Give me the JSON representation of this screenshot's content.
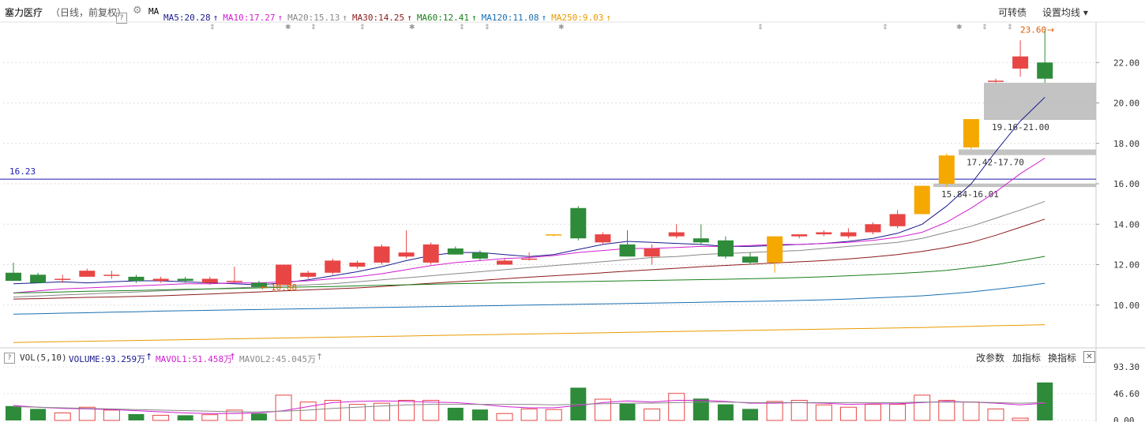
{
  "header": {
    "stock_name": "塞力医疗",
    "mode": "（日线，前复权）",
    "help": "?",
    "ma_label": "MA",
    "ma_items": [
      {
        "text": "MA5:20.28",
        "arrow": "↑",
        "color": "#1a1a8c"
      },
      {
        "text": "MA10:17.27",
        "arrow": "↑",
        "color": "#d020d0"
      },
      {
        "text": "MA20:15.13",
        "arrow": "↑",
        "color": "#888888"
      },
      {
        "text": "MA30:14.25",
        "arrow": "↑",
        "color": "#8b1a1a"
      },
      {
        "text": "MA60:12.41",
        "arrow": "↑",
        "color": "#1a7f1a"
      },
      {
        "text": "MA120:11.08",
        "arrow": "↑",
        "color": "#1a6fb0"
      },
      {
        "text": "MA250:9.03",
        "arrow": "↑",
        "color": "#e89b00"
      }
    ],
    "btn_convert": "可转债",
    "btn_setma": "设置均线 ▾"
  },
  "vol_header": {
    "help": "?",
    "label": "VOL(5,10)",
    "volume": "VOLUME:93.259万",
    "mavol1": "MAVOL1:51.458万",
    "mavol2": "MAVOL2:45.045万",
    "arrow": "↑",
    "btn_params": "改参数",
    "btn_add": "加指标",
    "btn_switch": "换指标",
    "btn_close": "✕"
  },
  "colors": {
    "up": "#e84545",
    "down": "#2e8b3a",
    "limit": "#f5a800",
    "hline": "#1a1ab0",
    "vol_up_fill": "#ffffff"
  },
  "chart_data": {
    "type": "candlestick",
    "y_ticks": [
      "22.00",
      "20.00",
      "18.00",
      "16.00",
      "14.00",
      "12.00",
      "10.00"
    ],
    "ylim": [
      8.0,
      24.0
    ],
    "hline": {
      "value": 16.23,
      "label": "16.23"
    },
    "max_label": "23.60",
    "min_label": "10.88",
    "gaps": [
      {
        "low": 19.16,
        "high": 21.0,
        "label": "19.16-21.00"
      },
      {
        "low": 17.42,
        "high": 17.7,
        "label": "17.42-17.70"
      },
      {
        "low": 15.84,
        "high": 16.01,
        "label": "15.84-16.01"
      }
    ],
    "candles": [
      {
        "o": 11.6,
        "h": 12.1,
        "l": 11.3,
        "c": 11.2
      },
      {
        "o": 11.5,
        "h": 11.6,
        "l": 11.1,
        "c": 11.1
      },
      {
        "o": 11.3,
        "h": 11.5,
        "l": 11.1,
        "c": 11.3
      },
      {
        "o": 11.4,
        "h": 11.8,
        "l": 11.4,
        "c": 11.7
      },
      {
        "o": 11.5,
        "h": 11.7,
        "l": 11.3,
        "c": 11.5
      },
      {
        "o": 11.4,
        "h": 11.5,
        "l": 11.1,
        "c": 11.2
      },
      {
        "o": 11.2,
        "h": 11.4,
        "l": 11.1,
        "c": 11.3
      },
      {
        "o": 11.3,
        "h": 11.4,
        "l": 11.1,
        "c": 11.2
      },
      {
        "o": 11.1,
        "h": 11.4,
        "l": 11.0,
        "c": 11.3
      },
      {
        "o": 11.2,
        "h": 11.9,
        "l": 11.1,
        "c": 11.2
      },
      {
        "o": 11.1,
        "h": 11.2,
        "l": 10.88,
        "c": 10.9
      },
      {
        "o": 11.0,
        "h": 12.0,
        "l": 11.0,
        "c": 12.0
      },
      {
        "o": 11.4,
        "h": 11.7,
        "l": 11.3,
        "c": 11.6
      },
      {
        "o": 11.6,
        "h": 12.3,
        "l": 11.5,
        "c": 12.2
      },
      {
        "o": 11.9,
        "h": 12.2,
        "l": 11.8,
        "c": 12.1
      },
      {
        "o": 12.1,
        "h": 13.0,
        "l": 12.0,
        "c": 12.9
      },
      {
        "o": 12.4,
        "h": 13.7,
        "l": 12.3,
        "c": 12.6
      },
      {
        "o": 12.1,
        "h": 13.1,
        "l": 12.0,
        "c": 13.0
      },
      {
        "o": 12.8,
        "h": 12.9,
        "l": 12.5,
        "c": 12.5
      },
      {
        "o": 12.6,
        "h": 12.7,
        "l": 12.2,
        "c": 12.3
      },
      {
        "o": 12.0,
        "h": 12.3,
        "l": 12.0,
        "c": 12.2
      },
      {
        "o": 12.3,
        "h": 12.6,
        "l": 12.2,
        "c": 12.3
      },
      {
        "o": 13.45,
        "h": 13.5,
        "l": 13.4,
        "c": 13.5
      },
      {
        "o": 14.8,
        "h": 14.9,
        "l": 13.2,
        "c": 13.3
      },
      {
        "o": 13.1,
        "h": 13.6,
        "l": 13.0,
        "c": 13.5
      },
      {
        "o": 13.0,
        "h": 13.7,
        "l": 12.4,
        "c": 12.4
      },
      {
        "o": 12.4,
        "h": 13.0,
        "l": 12.0,
        "c": 12.8
      },
      {
        "o": 13.4,
        "h": 14.0,
        "l": 13.3,
        "c": 13.6
      },
      {
        "o": 13.3,
        "h": 14.0,
        "l": 13.0,
        "c": 13.1
      },
      {
        "o": 13.2,
        "h": 13.4,
        "l": 12.3,
        "c": 12.4
      },
      {
        "o": 12.4,
        "h": 12.6,
        "l": 12.0,
        "c": 12.1
      },
      {
        "o": 12.1,
        "h": 13.4,
        "l": 11.6,
        "c": 13.4
      },
      {
        "o": 13.4,
        "h": 13.5,
        "l": 13.3,
        "c": 13.5
      },
      {
        "o": 13.5,
        "h": 13.7,
        "l": 13.4,
        "c": 13.6
      },
      {
        "o": 13.4,
        "h": 13.8,
        "l": 13.3,
        "c": 13.6
      },
      {
        "o": 13.6,
        "h": 14.1,
        "l": 13.5,
        "c": 14.0
      },
      {
        "o": 13.9,
        "h": 14.7,
        "l": 13.8,
        "c": 14.5
      },
      {
        "o": 14.5,
        "h": 15.9,
        "l": 14.5,
        "c": 15.9
      },
      {
        "o": 16.0,
        "h": 17.5,
        "l": 15.84,
        "c": 17.4
      },
      {
        "o": 17.8,
        "h": 19.2,
        "l": 17.7,
        "c": 19.2
      },
      {
        "o": 21.1,
        "h": 21.2,
        "l": 21.0,
        "c": 21.1
      },
      {
        "o": 21.7,
        "h": 23.1,
        "l": 21.3,
        "c": 22.3
      },
      {
        "o": 22.0,
        "h": 23.6,
        "l": 21.0,
        "c": 21.2
      }
    ],
    "ma_series": {
      "ma5": [
        11.05,
        11.1,
        11.15,
        11.1,
        11.15,
        11.2,
        11.2,
        11.15,
        11.1,
        11.05,
        11.0,
        11.1,
        11.25,
        11.45,
        11.65,
        11.9,
        12.2,
        12.45,
        12.6,
        12.6,
        12.5,
        12.4,
        12.5,
        12.75,
        13.0,
        13.15,
        13.1,
        13.05,
        13.0,
        12.9,
        12.9,
        12.95,
        13.0,
        13.05,
        13.15,
        13.3,
        13.55,
        14.0,
        14.9,
        16.0,
        17.6,
        19.1,
        20.28
      ],
      "ma10": [
        10.6,
        10.7,
        10.8,
        10.85,
        10.9,
        10.95,
        11.0,
        11.05,
        11.05,
        11.1,
        11.1,
        11.15,
        11.2,
        11.3,
        11.4,
        11.55,
        11.75,
        11.95,
        12.1,
        12.2,
        12.3,
        12.35,
        12.45,
        12.6,
        12.7,
        12.8,
        12.8,
        12.85,
        12.9,
        12.9,
        12.95,
        13.0,
        13.0,
        13.05,
        13.1,
        13.2,
        13.35,
        13.6,
        14.1,
        14.8,
        15.6,
        16.5,
        17.27
      ],
      "ma20": [
        10.4,
        10.45,
        10.5,
        10.55,
        10.6,
        10.65,
        10.7,
        10.75,
        10.8,
        10.85,
        10.9,
        10.95,
        11.0,
        11.05,
        11.15,
        11.25,
        11.35,
        11.45,
        11.55,
        11.65,
        11.75,
        11.85,
        11.95,
        12.05,
        12.15,
        12.25,
        12.35,
        12.4,
        12.5,
        12.55,
        12.6,
        12.65,
        12.7,
        12.8,
        12.9,
        13.0,
        13.1,
        13.3,
        13.6,
        13.9,
        14.3,
        14.7,
        15.13
      ],
      "ma30": [
        10.3,
        10.32,
        10.35,
        10.38,
        10.4,
        10.43,
        10.46,
        10.5,
        10.55,
        10.6,
        10.65,
        10.7,
        10.75,
        10.8,
        10.85,
        10.92,
        11.0,
        11.08,
        11.15,
        11.22,
        11.3,
        11.38,
        11.45,
        11.52,
        11.6,
        11.68,
        11.75,
        11.82,
        11.9,
        11.96,
        12.02,
        12.08,
        12.14,
        12.2,
        12.28,
        12.38,
        12.5,
        12.65,
        12.85,
        13.1,
        13.45,
        13.85,
        14.25
      ],
      "ma60": [
        10.6,
        10.62,
        10.65,
        10.68,
        10.7,
        10.72,
        10.75,
        10.78,
        10.8,
        10.82,
        10.85,
        10.88,
        10.9,
        10.92,
        10.95,
        10.98,
        11.0,
        11.03,
        11.06,
        11.08,
        11.1,
        11.12,
        11.14,
        11.16,
        11.18,
        11.2,
        11.22,
        11.24,
        11.26,
        11.28,
        11.3,
        11.33,
        11.36,
        11.4,
        11.45,
        11.5,
        11.56,
        11.63,
        11.72,
        11.85,
        12.0,
        12.2,
        12.41
      ],
      "ma120": [
        9.55,
        9.57,
        9.6,
        9.62,
        9.65,
        9.67,
        9.7,
        9.72,
        9.74,
        9.76,
        9.78,
        9.8,
        9.82,
        9.84,
        9.86,
        9.88,
        9.9,
        9.92,
        9.94,
        9.96,
        9.98,
        10.0,
        10.02,
        10.04,
        10.06,
        10.08,
        10.1,
        10.12,
        10.14,
        10.16,
        10.18,
        10.2,
        10.23,
        10.26,
        10.3,
        10.35,
        10.4,
        10.46,
        10.55,
        10.65,
        10.78,
        10.92,
        11.08
      ],
      "ma250": [
        8.15,
        8.17,
        8.19,
        8.21,
        8.23,
        8.25,
        8.27,
        8.29,
        8.31,
        8.33,
        8.35,
        8.37,
        8.39,
        8.41,
        8.43,
        8.45,
        8.47,
        8.49,
        8.51,
        8.53,
        8.55,
        8.57,
        8.59,
        8.61,
        8.63,
        8.65,
        8.67,
        8.69,
        8.71,
        8.73,
        8.75,
        8.77,
        8.79,
        8.81,
        8.83,
        8.85,
        8.87,
        8.89,
        8.92,
        8.95,
        8.98,
        9.0,
        9.03
      ]
    },
    "vol_ticks": [
      "93.30",
      "46.60",
      "0.00"
    ],
    "vol_ylim": [
      0,
      93.3
    ],
    "volumes": [
      25,
      20,
      13,
      23,
      18,
      11,
      9,
      9,
      10,
      18,
      12,
      44,
      32,
      35,
      28,
      30,
      35,
      35,
      22,
      19,
      12,
      20,
      19,
      57,
      37,
      29,
      20,
      47,
      38,
      28,
      20,
      33,
      35,
      27,
      23,
      28,
      28,
      44,
      35,
      32,
      20,
      4,
      66,
      93.259
    ],
    "mavol1": [
      26,
      23,
      21,
      20,
      19,
      17,
      15,
      13,
      12,
      12,
      13,
      17,
      24,
      31,
      33,
      34,
      33,
      32,
      31,
      28,
      24,
      22,
      22,
      26,
      31,
      34,
      32,
      35,
      35,
      33,
      30,
      30,
      31,
      30,
      28,
      29,
      29,
      31,
      33,
      32,
      30,
      27,
      30,
      51.458
    ],
    "mavol2": [
      24,
      23,
      22,
      21,
      20,
      19,
      18,
      17,
      16,
      15,
      15,
      16,
      18,
      21,
      23,
      25,
      27,
      28,
      28,
      28,
      28,
      28,
      27,
      28,
      29,
      30,
      30,
      31,
      32,
      32,
      31,
      31,
      31,
      31,
      31,
      31,
      31,
      32,
      32,
      32,
      31,
      30,
      31,
      45.045
    ]
  }
}
